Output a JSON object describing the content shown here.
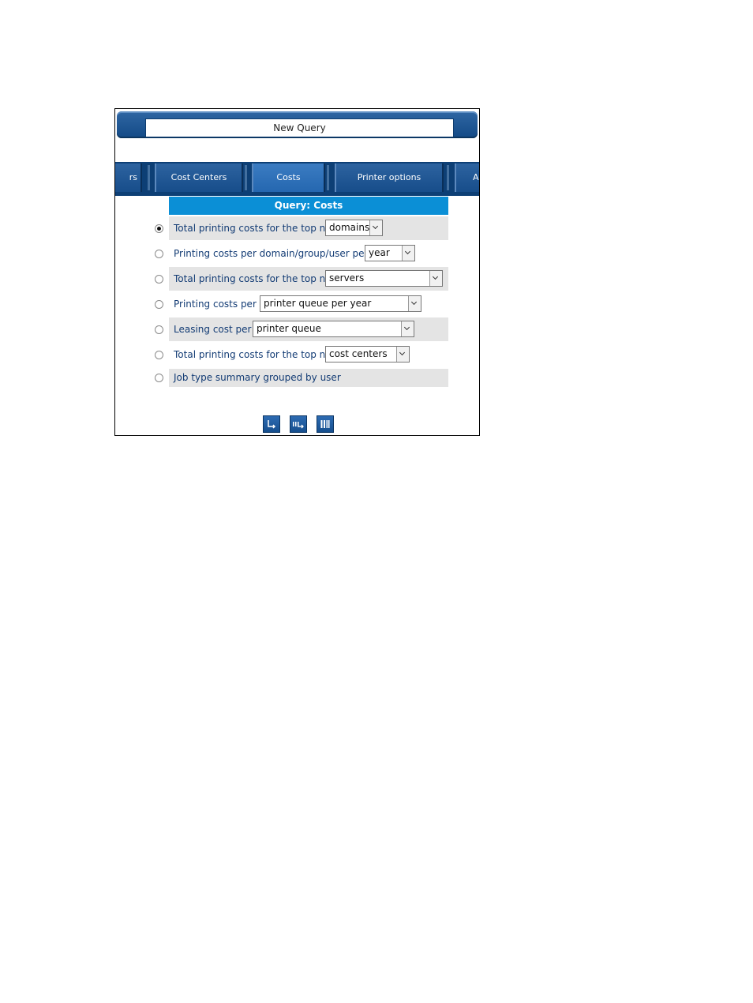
{
  "window": {
    "title": "New Query"
  },
  "tabs": [
    {
      "label": "rs"
    },
    {
      "label": "Cost Centers"
    },
    {
      "label": "Costs",
      "active": true
    },
    {
      "label": "Printer options"
    },
    {
      "label": "A"
    }
  ],
  "query": {
    "header": "Query: Costs",
    "options": [
      {
        "label": "Total printing costs for the top n",
        "selected": true,
        "select_value": "domains"
      },
      {
        "label": "Printing costs per domain/group/user per",
        "selected": false,
        "select_value": "year"
      },
      {
        "label": "Total printing costs for the top n",
        "selected": false,
        "select_value": "servers"
      },
      {
        "label": "Printing costs per",
        "selected": false,
        "select_value": "printer queue per year"
      },
      {
        "label": "Leasing cost per",
        "selected": false,
        "select_value": "printer queue"
      },
      {
        "label": "Total printing costs for the top n",
        "selected": false,
        "select_value": "cost centers"
      },
      {
        "label": "Job type summary grouped by user",
        "selected": false
      }
    ]
  },
  "actions": [
    {
      "icon": "run-query-icon"
    },
    {
      "icon": "run-chart-icon"
    },
    {
      "icon": "columns-icon"
    }
  ],
  "colors": {
    "header_blue": "#0b8fd6",
    "tab_blue": "#174d8a",
    "label_blue": "#123b74"
  }
}
